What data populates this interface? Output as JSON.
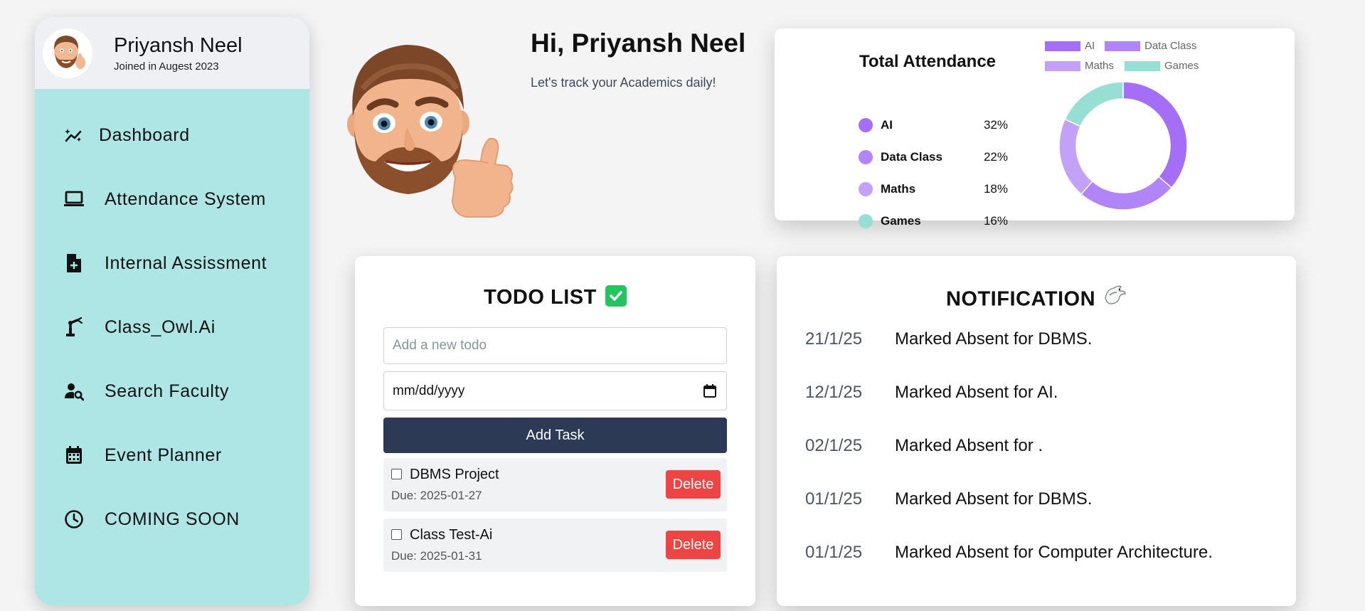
{
  "profile": {
    "name": "Priyansh Neel",
    "joined": "Joined in Augest 2023"
  },
  "sidebar": {
    "items": [
      {
        "label": "Dashboard",
        "icon": "chart-sparkle-icon"
      },
      {
        "label": "Attendance System",
        "icon": "laptop-icon"
      },
      {
        "label": "Internal Assissment",
        "icon": "file-add-icon"
      },
      {
        "label": "Class_Owl.Ai",
        "icon": "robot-arm-icon"
      },
      {
        "label": "Search Faculty",
        "icon": "person-search-icon"
      },
      {
        "label": "Event Planner",
        "icon": "calendar-icon"
      },
      {
        "label": "COMING SOON",
        "icon": "clock-icon"
      }
    ]
  },
  "hero": {
    "title": "Hi, Priyansh Neel",
    "subtitle": "Let's track your Academics daily!"
  },
  "attendance": {
    "title": "Total Attendance",
    "rows": [
      {
        "name": "AI",
        "percent": "32%",
        "color": "#a56ef6"
      },
      {
        "name": "Data Class",
        "percent": "22%",
        "color": "#b184f7"
      },
      {
        "name": "Maths",
        "percent": "18%",
        "color": "#c2a1f7"
      },
      {
        "name": "Games",
        "percent": "16%",
        "color": "#97dfd5"
      }
    ]
  },
  "chart_data": {
    "type": "pie",
    "categories": [
      "AI",
      "Data Class",
      "Maths",
      "Games"
    ],
    "values": [
      32,
      22,
      18,
      16
    ],
    "colors": [
      "#a56ef6",
      "#b184f7",
      "#c2a1f7",
      "#97dfd5"
    ],
    "legend": "top"
  },
  "todo": {
    "title": "TODO LIST",
    "input_placeholder": "Add a new todo",
    "date_placeholder": "mm/dd/yyyy",
    "add_label": "Add Task",
    "tasks": [
      {
        "name": "DBMS Project",
        "due": "Due: 2025-01-27",
        "delete_label": "Delete"
      },
      {
        "name": "Class Test-Ai",
        "due": "Due: 2025-01-31",
        "delete_label": "Delete"
      }
    ]
  },
  "notifications": {
    "title": "NOTIFICATION",
    "items": [
      {
        "date": "21/1/25",
        "message": "Marked Absent for DBMS."
      },
      {
        "date": "12/1/25",
        "message": "Marked Absent for AI."
      },
      {
        "date": "02/1/25",
        "message": "Marked Absent for ."
      },
      {
        "date": "01/1/25",
        "message": "Marked Absent for DBMS."
      },
      {
        "date": "01/1/25",
        "message": "Marked Absent for Computer Architecture."
      }
    ]
  }
}
